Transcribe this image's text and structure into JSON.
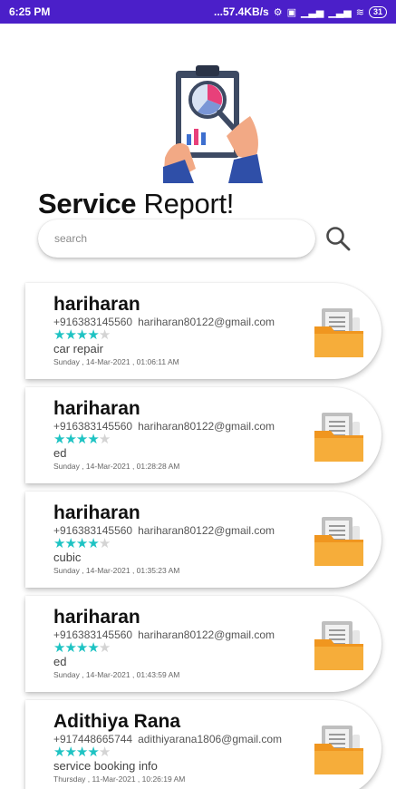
{
  "status_bar": {
    "time": "6:25 PM",
    "network_speed": "...57.4KB/s",
    "battery": "31"
  },
  "header": {
    "title_bold": "Service",
    "title_rest": " Report!",
    "hero_icon": "report-clipboard-magnifier-icon"
  },
  "search": {
    "placeholder": "search",
    "value": ""
  },
  "colors": {
    "status_bar": "#4b1fc9",
    "star_on": "#1ec3c3",
    "star_off": "#d4d4d4",
    "folder": "#f6a832"
  },
  "reports": [
    {
      "name": "hariharan",
      "phone": "+916383145560",
      "email": "hariharan80122@gmail.com",
      "rating": 4,
      "max_rating": 5,
      "service": "car repair",
      "date": "Sunday , 14-Mar-2021 , 01:06:11 AM"
    },
    {
      "name": "hariharan",
      "phone": "+916383145560",
      "email": "hariharan80122@gmail.com",
      "rating": 4,
      "max_rating": 5,
      "service": "ed",
      "date": "Sunday , 14-Mar-2021 , 01:28:28 AM"
    },
    {
      "name": "hariharan",
      "phone": "+916383145560",
      "email": "hariharan80122@gmail.com",
      "rating": 4,
      "max_rating": 5,
      "service": "cubic",
      "date": "Sunday , 14-Mar-2021 , 01:35:23 AM"
    },
    {
      "name": "hariharan",
      "phone": "+916383145560",
      "email": "hariharan80122@gmail.com",
      "rating": 4,
      "max_rating": 5,
      "service": "ed",
      "date": "Sunday , 14-Mar-2021 , 01:43:59 AM"
    },
    {
      "name": "Adithiya Rana",
      "phone": "+917448665744",
      "email": "adithiyarana1806@gmail.com",
      "rating": 4,
      "max_rating": 5,
      "service": "service booking info",
      "date": "Thursday , 11-Mar-2021 , 10:26:19 AM"
    }
  ]
}
